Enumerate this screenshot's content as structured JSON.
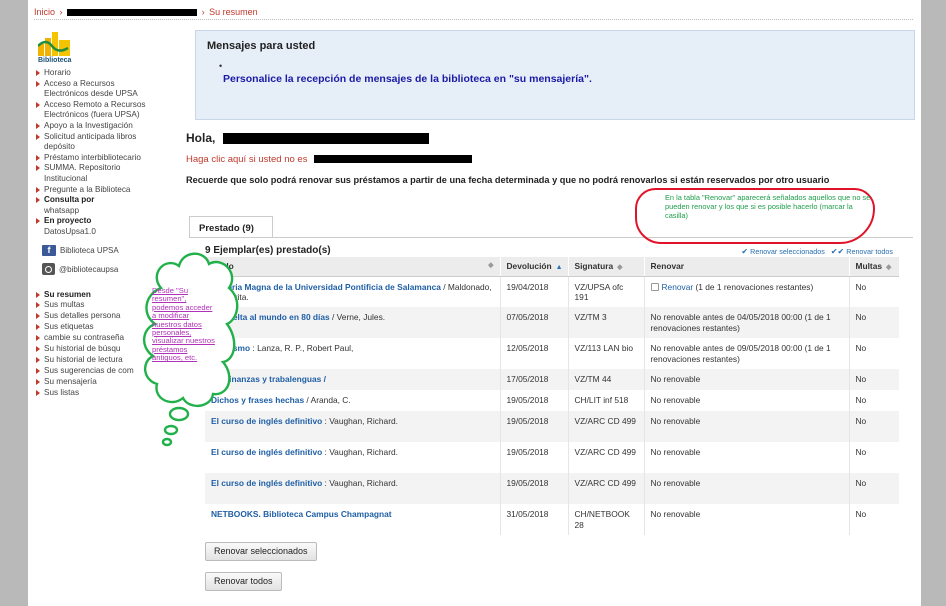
{
  "breadcrumb": {
    "home": "Inicio",
    "sep": "›",
    "current": "Su resumen"
  },
  "logo": {
    "label": "Biblioteca"
  },
  "sidebar": {
    "items": [
      {
        "label": "Horario",
        "bold": false
      },
      {
        "label": "Acceso a Recursos",
        "bold": false
      },
      {
        "label": "Electrónicos desde UPSA",
        "bold": false,
        "continuation": true
      },
      {
        "label": "Acceso Remoto a Recursos",
        "bold": false
      },
      {
        "label": "Electrónicos (fuera UPSA)",
        "bold": false,
        "continuation": true
      },
      {
        "label": "Apoyo a la Investigación",
        "bold": false
      },
      {
        "label": "Solicitud anticipada libros",
        "bold": false
      },
      {
        "label": "depósito",
        "bold": false,
        "continuation": true
      },
      {
        "label": "Préstamo interbibliotecario",
        "bold": false
      },
      {
        "label": "SUMMA. Repositorio",
        "bold": false
      },
      {
        "label": "Institucional",
        "bold": false,
        "continuation": true
      },
      {
        "label": "Pregunte a la Biblioteca",
        "bold": false
      },
      {
        "label": "Consulta por",
        "bold": true
      },
      {
        "label": "whatsapp",
        "bold": false,
        "continuation": true
      },
      {
        "label": "En proyecto",
        "bold": true
      },
      {
        "label": "DatosUpsa1.0",
        "bold": false,
        "continuation": true
      }
    ],
    "facebook": "Biblioteca UPSA",
    "instagram": "@bibliotecaupsa",
    "account_items": [
      {
        "label": "Su resumen",
        "bold": true
      },
      {
        "label": "Sus multas"
      },
      {
        "label": "Sus detalles persona"
      },
      {
        "label": "Sus etiquetas"
      },
      {
        "label": "cambie su contraseña"
      },
      {
        "label": "Su historial de búsqu"
      },
      {
        "label": "Su historial de lectura"
      },
      {
        "label": "Sus sugerencias de com"
      },
      {
        "label": "Su mensajería"
      },
      {
        "label": "Sus listas"
      }
    ]
  },
  "messages": {
    "title": "Mensajes para usted",
    "bullet": "•",
    "link": "Personalice la recepción de mensajes de la biblioteca en \"su mensajería\"."
  },
  "greeting": {
    "hello": "Hola,",
    "not_you": "Haga clic aquí si usted no es"
  },
  "notice": "Recuerde que solo podrá renovar sus préstamos a partir de una fecha determinada y que no podrá renovarlos si están reservados por otro usuario",
  "annotation_renew": "En la tabla \"Renovar\" aparecerá señalados aquellos que no se pueden renovar y los que si es posible hacerlo (marcar la casilla)",
  "annotation_cloud": "Desde \"Su resumen\", podemos acceder a modificar nuestros datos personales, visualizar nuestros préstamos antiguos, etc.",
  "tab": {
    "label": "Prestado (9)"
  },
  "count": "9 Ejemplar(es) prestado(s)",
  "renew_links": {
    "selected": "Renovar seleccionados",
    "all": "Renovar todos"
  },
  "table": {
    "headers": {
      "title": "Título",
      "due": "Devolución",
      "callnumber": "Signatura",
      "renew": "Renovar",
      "fines": "Multas"
    },
    "rows": [
      {
        "title": "Historia Magna de la Universidad Pontificia de Salamanca",
        "author": " / Maldonado, Margarita.",
        "due": "19/04/2018",
        "callnumber": "VZ/UPSA ofc 191",
        "renew_link": "Renovar",
        "renew_text": " (1 de 1 renovaciones restantes)",
        "renewable": true,
        "fines": "No"
      },
      {
        "title": "La vuelta al mundo en 80 días",
        "author": " / Verne, Jules.",
        "due": "07/05/2018",
        "callnumber": "VZ/TM 3",
        "renew_text": "No renovable antes de 04/05/2018 00:00 (1 de 1 renovaciones restantes)",
        "renewable": false,
        "fines": "No"
      },
      {
        "title": "Altruismo",
        "author": " : Lanza, R. P., Robert Paul,",
        "due": "12/05/2018",
        "callnumber": "VZ/113 LAN bio",
        "renew_text": "No renovable antes de 09/05/2018 00:00 (1 de 1 renovaciones restantes)",
        "renewable": false,
        "fines": "No"
      },
      {
        "title": "Adivinanzas y trabalenguas /",
        "author": "",
        "due": "17/05/2018",
        "callnumber": "VZ/TM 44",
        "renew_text": "No renovable",
        "renewable": false,
        "fines": "No"
      },
      {
        "title": "Dichos y frases hechas",
        "author": " / Aranda, C.",
        "due": "19/05/2018",
        "callnumber": "CH/LIT inf 518",
        "renew_text": "No renovable",
        "renewable": false,
        "fines": "No"
      },
      {
        "title": "El curso de inglés definitivo",
        "author": " : Vaughan, Richard.",
        "due": "19/05/2018",
        "callnumber": "VZ/ARC CD 499",
        "renew_text": "No renovable",
        "renewable": false,
        "fines": "No"
      },
      {
        "title": "El curso de inglés definitivo",
        "author": " : Vaughan, Richard.",
        "due": "19/05/2018",
        "callnumber": "VZ/ARC CD 499",
        "renew_text": "No renovable",
        "renewable": false,
        "fines": "No"
      },
      {
        "title": "El curso de inglés definitivo",
        "author": " : Vaughan, Richard.",
        "due": "19/05/2018",
        "callnumber": "VZ/ARC CD 499",
        "renew_text": "No renovable",
        "renewable": false,
        "fines": "No"
      },
      {
        "title": "NETBOOKS. Biblioteca Campus Champagnat",
        "author": "",
        "due": "31/05/2018",
        "callnumber": "CH/NETBOOK 28",
        "renew_text": "No renovable",
        "renewable": false,
        "fines": "No"
      }
    ]
  },
  "buttons": {
    "renew_selected": "Renovar seleccionados",
    "renew_all": "Renovar todos"
  },
  "colors": {
    "accent_red": "#c0392b",
    "link_blue": "#1f5fa6",
    "annotation_red": "#e0132a",
    "annotation_green": "#1e9e4a",
    "cloud_green": "#22b04b",
    "cloud_text": "#b032b8"
  }
}
